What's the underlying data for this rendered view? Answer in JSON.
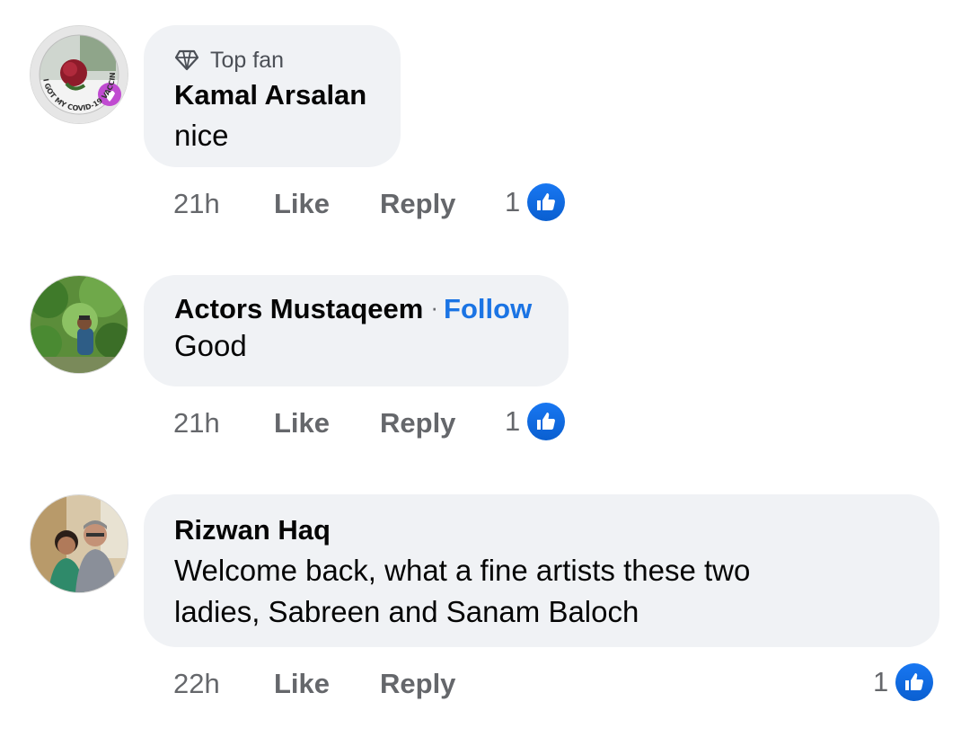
{
  "comments": [
    {
      "badge": "Top fan",
      "author": "Kamal Arsalan",
      "text": "nice",
      "time": "21h",
      "like_label": "Like",
      "reply_label": "Reply",
      "reaction_count": "1",
      "avatar_ring_text": "I GOT MY COVID-19 VACCINE"
    },
    {
      "author": "Actors Mustaqeem",
      "follow_label": "Follow",
      "separator": "·",
      "text": "Good",
      "time": "21h",
      "like_label": "Like",
      "reply_label": "Reply",
      "reaction_count": "1"
    },
    {
      "author": "Rizwan Haq",
      "text_line1": "Welcome back, what a fine artists these two",
      "text_line2": "ladies, Sabreen and Sanam Baloch",
      "time": "22h",
      "like_label": "Like",
      "reply_label": "Reply",
      "reaction_count": "1"
    }
  ],
  "colors": {
    "bubble": "#f0f2f5",
    "accent_blue": "#1b74e4",
    "meta_gray": "#65676b"
  }
}
